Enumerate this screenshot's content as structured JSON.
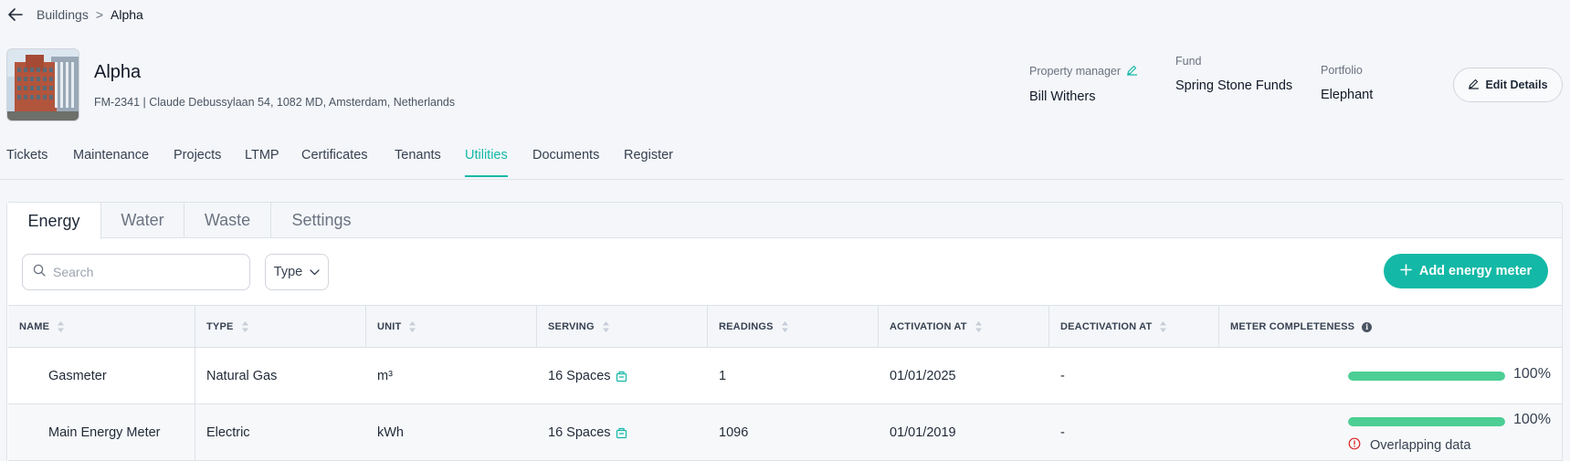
{
  "breadcrumb": {
    "parent": "Buildings",
    "separator": ">",
    "current": "Alpha"
  },
  "building": {
    "name": "Alpha",
    "subtitle": "FM-2341 | Claude Debussylaan 54, 1082 MD, Amsterdam, Netherlands"
  },
  "meta": {
    "property_manager_label": "Property manager",
    "property_manager_value": "Bill Withers",
    "fund_label": "Fund",
    "fund_value": "Spring Stone Funds",
    "portfolio_label": "Portfolio",
    "portfolio_value": "Elephant"
  },
  "edit_button_label": "Edit Details",
  "main_tabs": [
    "Tickets",
    "Maintenance",
    "Projects",
    "LTMP",
    "Certificates",
    "Tenants",
    "Utilities",
    "Documents",
    "Register"
  ],
  "active_main_tab": "Utilities",
  "sub_tabs": [
    "Energy",
    "Water",
    "Waste",
    "Settings"
  ],
  "active_sub_tab": "Energy",
  "search": {
    "placeholder": "Search",
    "value": ""
  },
  "type_filter_label": "Type",
  "add_button_label": "Add energy meter",
  "table": {
    "columns": [
      "NAME",
      "TYPE",
      "UNIT",
      "SERVING",
      "READINGS",
      "ACTIVATION AT",
      "DEACTIVATION AT",
      "METER COMPLETENESS"
    ],
    "rows": [
      {
        "name": "Gasmeter",
        "type": "Natural Gas",
        "unit": "m³",
        "serving": "16 Spaces",
        "readings": "1",
        "activation": "01/01/2025",
        "deactivation": "-",
        "completeness": 1.0,
        "completeness_label": "100%",
        "warning": ""
      },
      {
        "name": "Main Energy Meter",
        "type": "Electric",
        "unit": "kWh",
        "serving": "16 Spaces",
        "readings": "1096",
        "activation": "01/01/2019",
        "deactivation": "-",
        "completeness": 1.0,
        "completeness_label": "100%",
        "warning": "Overlapping data"
      }
    ]
  },
  "colors": {
    "accent": "#14b8a6",
    "progress": "#4cce94",
    "warning": "#dc2626"
  }
}
